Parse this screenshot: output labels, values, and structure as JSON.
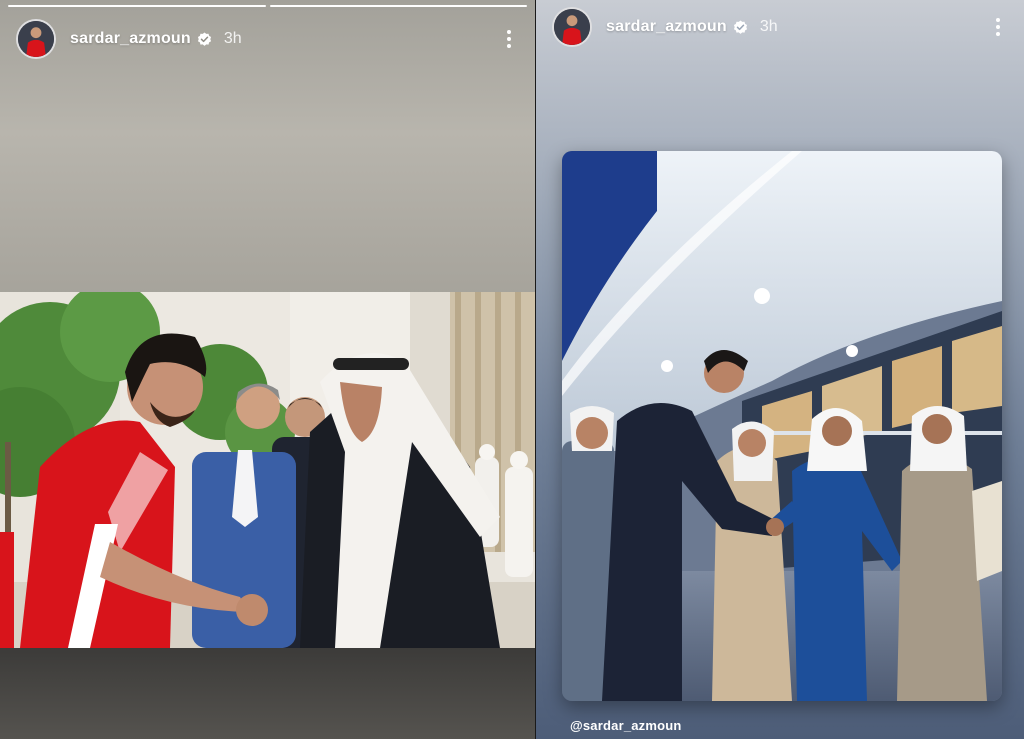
{
  "stories": [
    {
      "username": "sardar_azmoun",
      "time_ago": "3h",
      "progress_segments": 2,
      "active_segment": 0
    },
    {
      "username": "sardar_azmoun",
      "time_ago": "3h",
      "mention": "@sardar_azmoun"
    }
  ],
  "icons": {
    "verified": "verified-badge-icon",
    "more": "more-vertical-icon"
  },
  "colors": {
    "jersey_red": "#d8141b",
    "verified_white": "#ffffff",
    "thobe_blue": "#1d4f9a"
  }
}
